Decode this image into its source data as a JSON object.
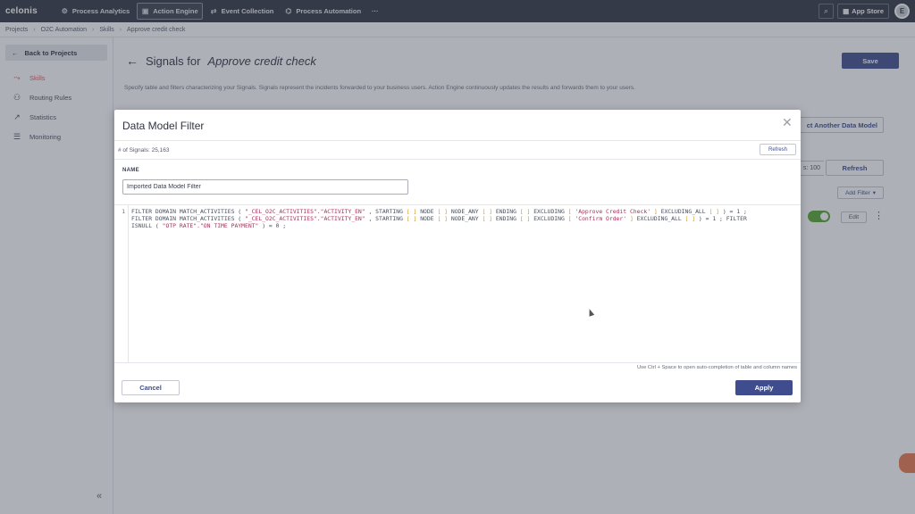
{
  "nav": {
    "logo": "celonis",
    "items": [
      {
        "label": "Process Analytics",
        "icon": "analytics-icon"
      },
      {
        "label": "Action Engine",
        "icon": "action-engine-icon"
      },
      {
        "label": "Event Collection",
        "icon": "event-collection-icon"
      },
      {
        "label": "Process Automation",
        "icon": "process-automation-icon"
      }
    ],
    "more": "···",
    "app_store": "App Store",
    "avatar_initial": "E"
  },
  "breadcrumb": [
    "Projects",
    "O2C Automation",
    "Skills",
    "Approve credit check"
  ],
  "sidebar": {
    "back_label": "Back to Projects",
    "items": [
      {
        "label": "Skills",
        "icon": "skills-icon",
        "active": true
      },
      {
        "label": "Routing Rules",
        "icon": "routing-icon"
      },
      {
        "label": "Statistics",
        "icon": "statistics-icon"
      },
      {
        "label": "Monitoring",
        "icon": "monitoring-icon"
      }
    ]
  },
  "page": {
    "title_prefix": "Signals for",
    "title_name": "Approve credit check",
    "description": "Specify table and filters characterizing your Signals. Signals represent the incidents forwarded to your business users. Action Engine continuously updates the results and forwards them to your users.",
    "save": "Save",
    "select_data_model": "ct Another Data Model",
    "limit": "s: 100",
    "refresh": "Refresh",
    "add_filter": "Add Filter",
    "edit": "Edit"
  },
  "modal": {
    "title": "Data Model Filter",
    "signals_count": "# of Signals: 25,163",
    "refresh": "Refresh",
    "name_label": "NAME",
    "name_value": "Imported Data Model Filter",
    "line_number": "1",
    "code": {
      "l1_a": "FILTER DOMAIN MATCH_ACTIVITIES ( ",
      "l1_s1": "\"_CEL_O2C_ACTIVITIES\".\"ACTIVITY_EN\"",
      "l1_b": " , STARTING ",
      "l1_br1": "[ ]",
      "l1_c": " NODE ",
      "l1_br2": "[ ]",
      "l1_d": " NODE_ANY ",
      "l1_br3": "[ ]",
      "l1_e": " ENDING ",
      "l1_br4": "[ ]",
      "l1_f": " EXCLUDING ",
      "l1_br5o": "[ ",
      "l1_s2": "'Approve Credit Check'",
      "l1_br5c": " ]",
      "l1_g": " EXCLUDING_ALL ",
      "l1_br6": "[ ]",
      "l1_h": " ) = 1 ;",
      "l2_a": "FILTER DOMAIN MATCH_ACTIVITIES ( ",
      "l2_s1": "\"_CEL_O2C_ACTIVITIES\".\"ACTIVITY_EN\"",
      "l2_b": " , STARTING ",
      "l2_br1": "[ ]",
      "l2_c": " NODE ",
      "l2_br2": "[ ]",
      "l2_d": " NODE_ANY ",
      "l2_br3": "[ ]",
      "l2_e": " ENDING ",
      "l2_br4": "[ ]",
      "l2_f": " EXCLUDING ",
      "l2_br5o": "[ ",
      "l2_s2": "'Confirm Order'",
      "l2_br5c": " ]",
      "l2_g": " EXCLUDING_ALL ",
      "l2_br6": "[ ]",
      "l2_h": " ) = 1 ; FILTER",
      "l3_a": "ISNULL ( ",
      "l3_s1": "\"OTP RATE\".\"ON TIME PAYMENT\"",
      "l3_b": " ) = 0 ;"
    },
    "hint": "Use Ctrl + Space to open auto-completion of table and column names",
    "cancel": "Cancel",
    "apply": "Apply"
  },
  "colors": {
    "primary": "#3f4d8e",
    "nav_bg": "#2f3441",
    "active_sidebar": "#e4595e",
    "toggle_on": "#55a630"
  }
}
